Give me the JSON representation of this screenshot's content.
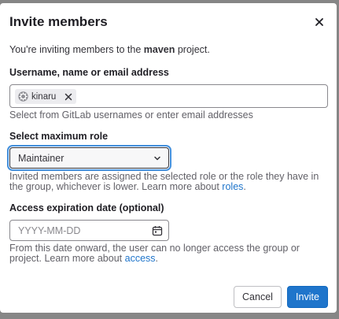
{
  "modal": {
    "title": "Invite members",
    "intro_prefix": "You're inviting members to the ",
    "project_name": "maven",
    "intro_suffix": " project."
  },
  "members_field": {
    "label": "Username, name or email address",
    "tokens": [
      {
        "name": "kinaru"
      }
    ],
    "help": "Select from GitLab usernames or enter email addresses"
  },
  "role_field": {
    "label": "Select maximum role",
    "selected": "Maintainer",
    "help_prefix": "Invited members are assigned the selected role or the role they have in the group, whichever is lower. Learn more about ",
    "help_link": "roles",
    "help_suffix": "."
  },
  "expiration_field": {
    "label": "Access expiration date (optional)",
    "placeholder": "YYYY-MM-DD",
    "value": "",
    "help_prefix": "From this date onward, the user can no longer access the group or project. Learn more about ",
    "help_link": "access",
    "help_suffix": "."
  },
  "footer": {
    "cancel_label": "Cancel",
    "invite_label": "Invite"
  },
  "colors": {
    "primary": "#1f75cb",
    "link": "#1f75cb",
    "focus_ring": "#428fdc",
    "backdrop": "#868686"
  },
  "icons": {
    "close": "close-icon",
    "token_avatar": "avatar-icon",
    "token_remove": "remove-token-icon",
    "select_chevron": "chevron-down-icon",
    "calendar": "calendar-icon"
  }
}
